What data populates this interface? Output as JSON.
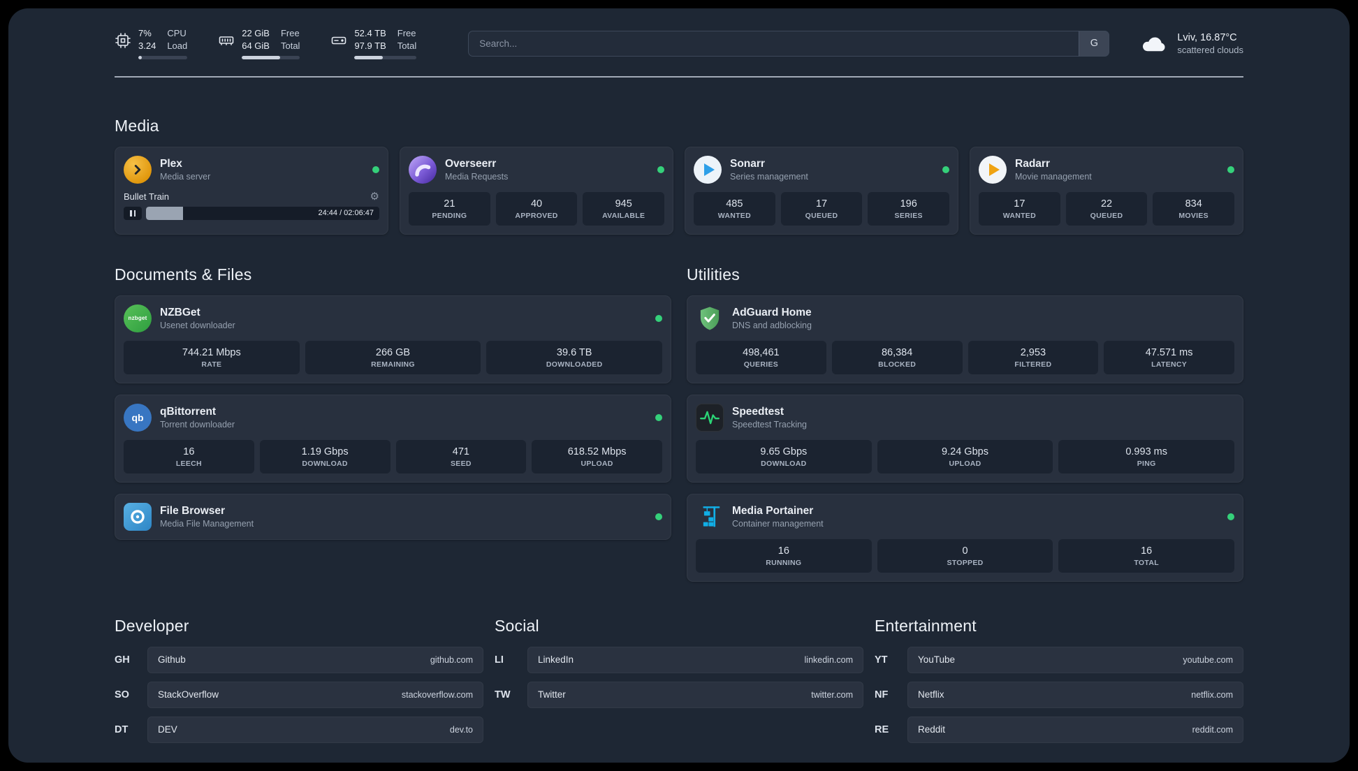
{
  "theme": {
    "background": "#1e2734",
    "card": "#28303e",
    "stat_box": "#1b2330",
    "status_green": "#35d07a"
  },
  "icons": {
    "gear": "⚙",
    "nzbget_label": "nzbget",
    "qbittorrent_label": "qb"
  },
  "topbar": {
    "cpu": {
      "value1": "7%",
      "value2": "3.24",
      "label1": "CPU",
      "label2": "Load",
      "bar_percent": 7
    },
    "memory": {
      "value1": "22 GiB",
      "value2": "64 GiB",
      "label1": "Free",
      "label2": "Total",
      "bar_percent": 66
    },
    "disk": {
      "value1": "52.4 TB",
      "value2": "97.9 TB",
      "label1": "Free",
      "label2": "Total",
      "bar_percent": 46
    },
    "search": {
      "placeholder": "Search...",
      "button": "G"
    },
    "weather": {
      "location": "Lviv, 16.87°C",
      "condition": "scattered clouds"
    }
  },
  "sections": {
    "media": {
      "title": "Media",
      "plex": {
        "name": "Plex",
        "description": "Media server",
        "now_playing": {
          "title": "Bullet Train",
          "time": "24:44 / 02:06:47",
          "progress_percent": 16
        }
      },
      "overseerr": {
        "name": "Overseerr",
        "description": "Media Requests",
        "stats": [
          {
            "value": "21",
            "label": "PENDING"
          },
          {
            "value": "40",
            "label": "APPROVED"
          },
          {
            "value": "945",
            "label": "AVAILABLE"
          }
        ]
      },
      "sonarr": {
        "name": "Sonarr",
        "description": "Series management",
        "stats": [
          {
            "value": "485",
            "label": "WANTED"
          },
          {
            "value": "17",
            "label": "QUEUED"
          },
          {
            "value": "196",
            "label": "SERIES"
          }
        ]
      },
      "radarr": {
        "name": "Radarr",
        "description": "Movie management",
        "stats": [
          {
            "value": "17",
            "label": "WANTED"
          },
          {
            "value": "22",
            "label": "QUEUED"
          },
          {
            "value": "834",
            "label": "MOVIES"
          }
        ]
      }
    },
    "documents": {
      "title": "Documents & Files",
      "nzbget": {
        "name": "NZBGet",
        "description": "Usenet downloader",
        "stats": [
          {
            "value": "744.21 Mbps",
            "label": "RATE"
          },
          {
            "value": "266 GB",
            "label": "REMAINING"
          },
          {
            "value": "39.6 TB",
            "label": "DOWNLOADED"
          }
        ]
      },
      "qbittorrent": {
        "name": "qBittorrent",
        "description": "Torrent downloader",
        "stats": [
          {
            "value": "16",
            "label": "LEECH"
          },
          {
            "value": "1.19 Gbps",
            "label": "DOWNLOAD"
          },
          {
            "value": "471",
            "label": "SEED"
          },
          {
            "value": "618.52 Mbps",
            "label": "UPLOAD"
          }
        ]
      },
      "filebrowser": {
        "name": "File Browser",
        "description": "Media File Management"
      }
    },
    "utilities": {
      "title": "Utilities",
      "adguard": {
        "name": "AdGuard Home",
        "description": "DNS and adblocking",
        "stats": [
          {
            "value": "498,461",
            "label": "QUERIES"
          },
          {
            "value": "86,384",
            "label": "BLOCKED"
          },
          {
            "value": "2,953",
            "label": "FILTERED"
          },
          {
            "value": "47.571 ms",
            "label": "LATENCY"
          }
        ]
      },
      "speedtest": {
        "name": "Speedtest",
        "description": "Speedtest Tracking",
        "stats": [
          {
            "value": "9.65 Gbps",
            "label": "DOWNLOAD"
          },
          {
            "value": "9.24 Gbps",
            "label": "UPLOAD"
          },
          {
            "value": "0.993 ms",
            "label": "PING"
          }
        ]
      },
      "portainer": {
        "name": "Media Portainer",
        "description": "Container management",
        "stats": [
          {
            "value": "16",
            "label": "RUNNING"
          },
          {
            "value": "0",
            "label": "STOPPED"
          },
          {
            "value": "16",
            "label": "TOTAL"
          }
        ]
      }
    }
  },
  "bookmarks": {
    "developer": {
      "title": "Developer",
      "links": [
        {
          "abbr": "GH",
          "name": "Github",
          "domain": "github.com"
        },
        {
          "abbr": "SO",
          "name": "StackOverflow",
          "domain": "stackoverflow.com"
        },
        {
          "abbr": "DT",
          "name": "DEV",
          "domain": "dev.to"
        }
      ]
    },
    "social": {
      "title": "Social",
      "links": [
        {
          "abbr": "LI",
          "name": "LinkedIn",
          "domain": "linkedin.com"
        },
        {
          "abbr": "TW",
          "name": "Twitter",
          "domain": "twitter.com"
        }
      ]
    },
    "entertainment": {
      "title": "Entertainment",
      "links": [
        {
          "abbr": "YT",
          "name": "YouTube",
          "domain": "youtube.com"
        },
        {
          "abbr": "NF",
          "name": "Netflix",
          "domain": "netflix.com"
        },
        {
          "abbr": "RE",
          "name": "Reddit",
          "domain": "reddit.com"
        }
      ]
    }
  }
}
